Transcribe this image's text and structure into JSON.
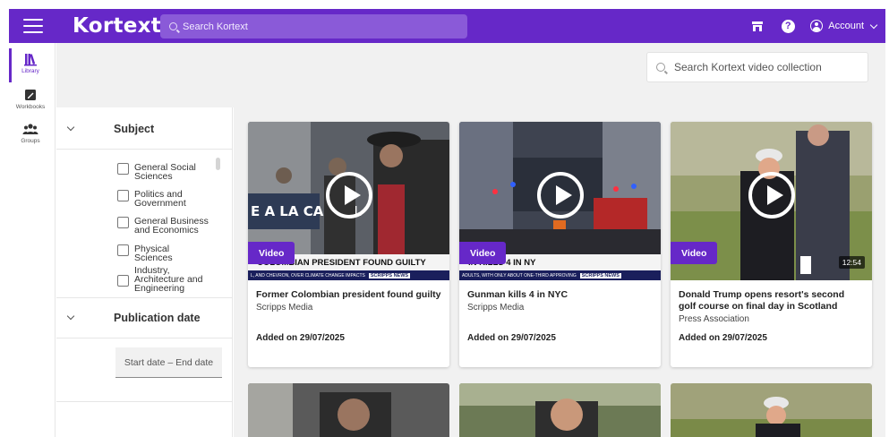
{
  "app": {
    "logo": "Kortext"
  },
  "topbar": {
    "search_placeholder": "Search Kortext",
    "account_label": "Account"
  },
  "rail": {
    "items": [
      {
        "label": "Library",
        "icon": "library-icon",
        "active": true
      },
      {
        "label": "Workbooks",
        "icon": "workbook-icon",
        "active": false
      },
      {
        "label": "Groups",
        "icon": "groups-icon",
        "active": false
      }
    ]
  },
  "collection_search": {
    "placeholder": "Search Kortext video collection"
  },
  "filters": {
    "subject": {
      "title": "Subject",
      "options": [
        "General Social Sciences",
        "Politics and Government",
        "General Business and Economics",
        "Physical Sciences",
        "Industry, Architecture and Engineering"
      ]
    },
    "publication_date": {
      "title": "Publication date",
      "range_placeholder": "Start date – End date"
    }
  },
  "videos": [
    {
      "badge": "Video",
      "title": "Former Colombian president found guilty",
      "source": "Scripps Media",
      "added": "Added on 29/07/2025",
      "lower_third": "COLOMBIAN PRESIDENT FOUND GUILTY",
      "ticker": "L, AND CHEVRON, OVER CLIMATE CHANGE IMPACTS",
      "ticker_brand": "SCRIPPS NEWS",
      "duration": ""
    },
    {
      "badge": "Video",
      "title": "Gunman kills 4 in NYC",
      "source": "Scripps Media",
      "added": "Added on 29/07/2025",
      "lower_third": "IN KILLS 4 IN NY",
      "ticker": "ADULTS, WITH ONLY ABOUT ONE-THIRD APPROVING",
      "ticker_brand": "SCRIPPS NEWS",
      "duration": ""
    },
    {
      "badge": "Video",
      "title": "Donald Trump opens resort's second golf course on final day in Scotland",
      "source": "Press Association",
      "added": "Added on 29/07/2025",
      "lower_third": "",
      "ticker": "",
      "ticker_brand": "",
      "duration": "12:54"
    }
  ],
  "colors": {
    "brand_purple": "#6628c8",
    "page_bg": "#f1f1f1",
    "ticker_navy": "#1a1f5c"
  }
}
